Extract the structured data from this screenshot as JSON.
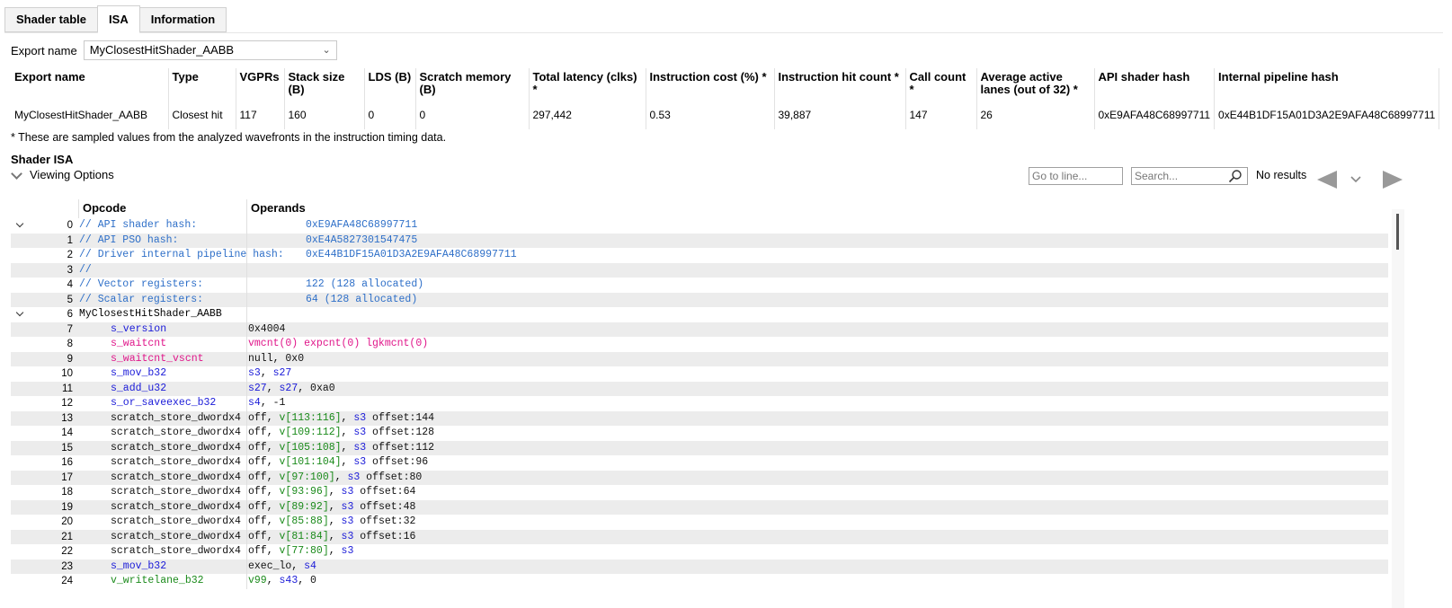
{
  "tabs": [
    {
      "label": "Shader table",
      "active": false
    },
    {
      "label": "ISA",
      "active": true
    },
    {
      "label": "Information",
      "active": false
    }
  ],
  "export": {
    "label": "Export name",
    "selected": "MyClosestHitShader_AABB"
  },
  "info_table": {
    "headers": [
      "Export name",
      "Type",
      "VGPRs",
      "Stack size (B)",
      "LDS (B)",
      "Scratch memory (B)",
      "Total latency (clks) *",
      "Instruction cost (%) *",
      "Instruction hit count *",
      "Call count *",
      "Average active lanes (out of 32) *",
      "API shader hash",
      "Internal pipeline hash"
    ],
    "row": [
      "MyClosestHitShader_AABB",
      "Closest hit",
      "117",
      "160",
      "0",
      "0",
      "297,442",
      "0.53",
      "39,887",
      "147",
      "26",
      "0xE9AFA48C68997711",
      "0xE44B1DF15A01D3A2E9AFA48C68997711"
    ]
  },
  "footnote": "* These are sampled values from the analyzed wavefronts in the instruction timing data.",
  "section_title": "Shader ISA",
  "viewing_options": "Viewing Options",
  "goto_placeholder": "Go to line...",
  "search_placeholder": "Search...",
  "no_results": "No results",
  "isa_headers": {
    "opcode": "Opcode",
    "operands": "Operands"
  },
  "colors": {
    "comment": "#2e6fc8",
    "salu": "#1a1ad8",
    "waitcnt": "#e0168a",
    "valu": "#1a8a1a"
  },
  "isa_rows": [
    {
      "n": "0",
      "expander": true,
      "comment": "// API shader hash:",
      "operands": [
        [
          "plain",
          "                  0xE9AFA48C68997711"
        ]
      ],
      "kind": "comment"
    },
    {
      "n": "1",
      "comment": "// API PSO hash:",
      "operands": [
        [
          "plain",
          "                     0xE4A5827301547475"
        ]
      ],
      "kind": "comment"
    },
    {
      "n": "2",
      "comment": "// Driver internal pipeline hash:",
      "operands": [
        [
          "plain",
          "    0xE44B1DF15A01D3A2E9AFA48C68997711"
        ]
      ],
      "kind": "comment"
    },
    {
      "n": "3",
      "comment": "//",
      "operands": [],
      "kind": "comment"
    },
    {
      "n": "4",
      "comment": "// Vector registers:",
      "operands": [
        [
          "plain",
          "                 122 (128 allocated)"
        ]
      ],
      "kind": "comment"
    },
    {
      "n": "5",
      "comment": "// Scalar registers:",
      "operands": [
        [
          "plain",
          "                 64 (128 allocated)"
        ]
      ],
      "kind": "comment"
    },
    {
      "n": "6",
      "expander": true,
      "label": "MyClosestHitShader_AABB",
      "kind": "label"
    },
    {
      "n": "7",
      "op": "s_version",
      "opc": "salu",
      "operands": [
        [
          "plain",
          "0x4004"
        ]
      ]
    },
    {
      "n": "8",
      "op": "s_waitcnt",
      "opc": "wait",
      "operands": [
        [
          "wait",
          "vmcnt(0) expcnt(0) lgkmcnt(0)"
        ]
      ]
    },
    {
      "n": "9",
      "op": "s_waitcnt_vscnt",
      "opc": "wait",
      "operands": [
        [
          "plain",
          "null, 0x0"
        ]
      ]
    },
    {
      "n": "10",
      "op": "s_mov_b32",
      "opc": "salu",
      "operands": [
        [
          "sreg",
          "s3"
        ],
        [
          "plain",
          ", "
        ],
        [
          "sreg",
          "s27"
        ]
      ]
    },
    {
      "n": "11",
      "op": "s_add_u32",
      "opc": "salu",
      "operands": [
        [
          "sreg",
          "s27"
        ],
        [
          "plain",
          ", "
        ],
        [
          "sreg",
          "s27"
        ],
        [
          "plain",
          ", 0xa0"
        ]
      ]
    },
    {
      "n": "12",
      "op": "s_or_saveexec_b32",
      "opc": "salu",
      "operands": [
        [
          "sreg",
          "s4"
        ],
        [
          "plain",
          ", -1"
        ]
      ]
    },
    {
      "n": "13",
      "op": "scratch_store_dwordx4",
      "opc": "mem",
      "operands": [
        [
          "plain",
          "off, "
        ],
        [
          "vreg",
          "v[113:116]"
        ],
        [
          "plain",
          ", "
        ],
        [
          "sreg",
          "s3"
        ],
        [
          "plain",
          " offset:144"
        ]
      ]
    },
    {
      "n": "14",
      "op": "scratch_store_dwordx4",
      "opc": "mem",
      "operands": [
        [
          "plain",
          "off, "
        ],
        [
          "vreg",
          "v[109:112]"
        ],
        [
          "plain",
          ", "
        ],
        [
          "sreg",
          "s3"
        ],
        [
          "plain",
          " offset:128"
        ]
      ]
    },
    {
      "n": "15",
      "op": "scratch_store_dwordx4",
      "opc": "mem",
      "operands": [
        [
          "plain",
          "off, "
        ],
        [
          "vreg",
          "v[105:108]"
        ],
        [
          "plain",
          ", "
        ],
        [
          "sreg",
          "s3"
        ],
        [
          "plain",
          " offset:112"
        ]
      ]
    },
    {
      "n": "16",
      "op": "scratch_store_dwordx4",
      "opc": "mem",
      "operands": [
        [
          "plain",
          "off, "
        ],
        [
          "vreg",
          "v[101:104]"
        ],
        [
          "plain",
          ", "
        ],
        [
          "sreg",
          "s3"
        ],
        [
          "plain",
          " offset:96"
        ]
      ]
    },
    {
      "n": "17",
      "op": "scratch_store_dwordx4",
      "opc": "mem",
      "operands": [
        [
          "plain",
          "off, "
        ],
        [
          "vreg",
          "v[97:100]"
        ],
        [
          "plain",
          ", "
        ],
        [
          "sreg",
          "s3"
        ],
        [
          "plain",
          " offset:80"
        ]
      ]
    },
    {
      "n": "18",
      "op": "scratch_store_dwordx4",
      "opc": "mem",
      "operands": [
        [
          "plain",
          "off, "
        ],
        [
          "vreg",
          "v[93:96]"
        ],
        [
          "plain",
          ", "
        ],
        [
          "sreg",
          "s3"
        ],
        [
          "plain",
          " offset:64"
        ]
      ]
    },
    {
      "n": "19",
      "op": "scratch_store_dwordx4",
      "opc": "mem",
      "operands": [
        [
          "plain",
          "off, "
        ],
        [
          "vreg",
          "v[89:92]"
        ],
        [
          "plain",
          ", "
        ],
        [
          "sreg",
          "s3"
        ],
        [
          "plain",
          " offset:48"
        ]
      ]
    },
    {
      "n": "20",
      "op": "scratch_store_dwordx4",
      "opc": "mem",
      "operands": [
        [
          "plain",
          "off, "
        ],
        [
          "vreg",
          "v[85:88]"
        ],
        [
          "plain",
          ", "
        ],
        [
          "sreg",
          "s3"
        ],
        [
          "plain",
          " offset:32"
        ]
      ]
    },
    {
      "n": "21",
      "op": "scratch_store_dwordx4",
      "opc": "mem",
      "operands": [
        [
          "plain",
          "off, "
        ],
        [
          "vreg",
          "v[81:84]"
        ],
        [
          "plain",
          ", "
        ],
        [
          "sreg",
          "s3"
        ],
        [
          "plain",
          " offset:16"
        ]
      ]
    },
    {
      "n": "22",
      "op": "scratch_store_dwordx4",
      "opc": "mem",
      "operands": [
        [
          "plain",
          "off, "
        ],
        [
          "vreg",
          "v[77:80]"
        ],
        [
          "plain",
          ", "
        ],
        [
          "sreg",
          "s3"
        ]
      ]
    },
    {
      "n": "23",
      "op": "s_mov_b32",
      "opc": "salu",
      "operands": [
        [
          "plain",
          "exec_lo, "
        ],
        [
          "sreg",
          "s4"
        ]
      ]
    },
    {
      "n": "24",
      "op": "v_writelane_b32",
      "opc": "valu",
      "operands": [
        [
          "vreg",
          "v99"
        ],
        [
          "plain",
          ", "
        ],
        [
          "sreg",
          "s43"
        ],
        [
          "plain",
          ", 0"
        ]
      ]
    }
  ]
}
